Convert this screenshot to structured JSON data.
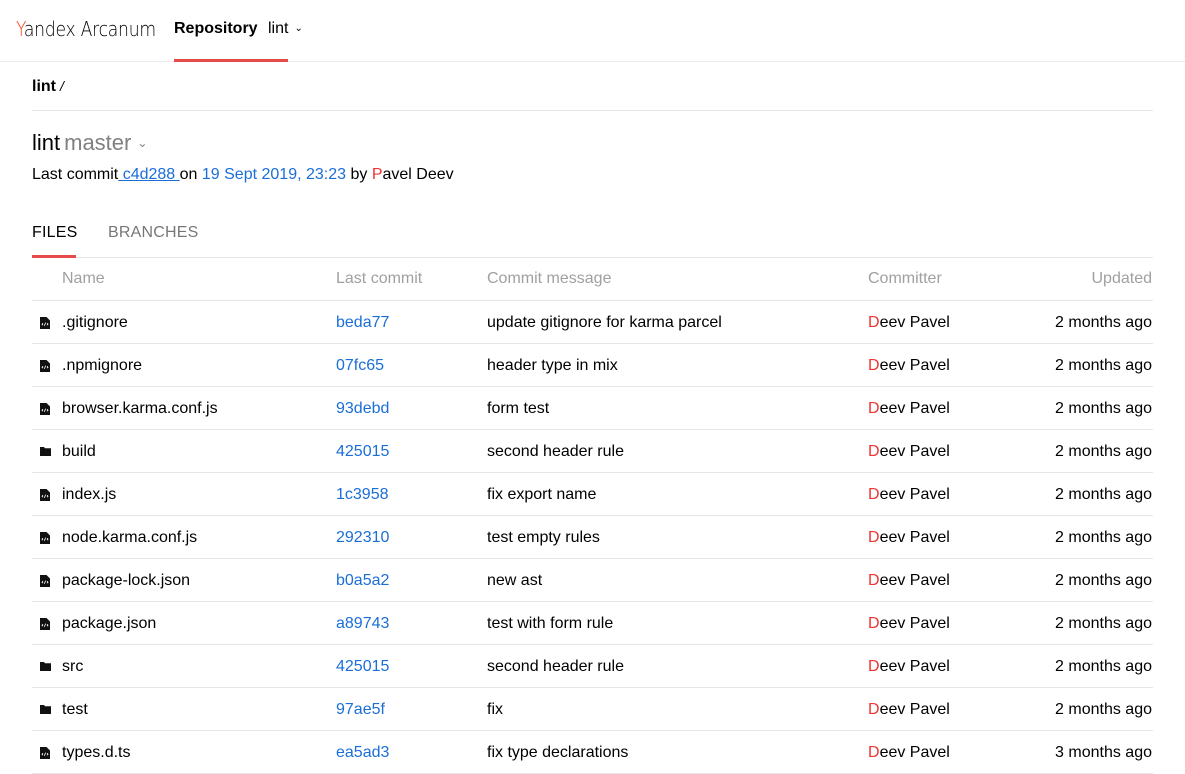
{
  "header": {
    "logo_yandex_first": "Y",
    "logo_yandex_rest": "andex",
    "logo_product": "Arcanum",
    "nav_label": "Repository",
    "repo_selector": "lint"
  },
  "breadcrumb": {
    "repo": "lint",
    "separator": "/"
  },
  "repo": {
    "name": "lint",
    "branch": "master"
  },
  "last_commit": {
    "prefix": "Last commit",
    "hash": " c4d288 ",
    "on": "on ",
    "date": "19 Sept 2019, 23:23",
    "by": " by ",
    "author_first": "P",
    "author_rest": "avel Deev"
  },
  "tabs": [
    {
      "label": "FILES",
      "active": true
    },
    {
      "label": "BRANCHES",
      "active": false
    }
  ],
  "table": {
    "headers": {
      "name": "Name",
      "last_commit": "Last commit",
      "message": "Commit message",
      "committer": "Committer",
      "updated": "Updated"
    },
    "rows": [
      {
        "type": "file",
        "icon": "file-icon",
        "name": ".gitignore",
        "commit": "beda77",
        "message": "update gitignore for karma parcel",
        "committer_first": "D",
        "committer_rest": "eev Pavel",
        "updated": "2 months ago"
      },
      {
        "type": "file",
        "icon": "file-icon",
        "name": ".npmignore",
        "commit": "07fc65",
        "message": "header type in mix",
        "committer_first": "D",
        "committer_rest": "eev Pavel",
        "updated": "2 months ago"
      },
      {
        "type": "file",
        "icon": "file-icon",
        "name": "browser.karma.conf.js",
        "commit": "93debd",
        "message": "form test",
        "committer_first": "D",
        "committer_rest": "eev Pavel",
        "updated": "2 months ago"
      },
      {
        "type": "folder",
        "icon": "folder-icon",
        "name": "build",
        "commit": "425015",
        "message": "second header rule",
        "committer_first": "D",
        "committer_rest": "eev Pavel",
        "updated": "2 months ago"
      },
      {
        "type": "file",
        "icon": "file-icon",
        "name": "index.js",
        "commit": "1c3958",
        "message": "fix export name",
        "committer_first": "D",
        "committer_rest": "eev Pavel",
        "updated": "2 months ago"
      },
      {
        "type": "file",
        "icon": "file-icon",
        "name": "node.karma.conf.js",
        "commit": "292310",
        "message": "test empty rules",
        "committer_first": "D",
        "committer_rest": "eev Pavel",
        "updated": "2 months ago"
      },
      {
        "type": "file",
        "icon": "file-icon",
        "name": "package-lock.json",
        "commit": "b0a5a2",
        "message": "new ast",
        "committer_first": "D",
        "committer_rest": "eev Pavel",
        "updated": "2 months ago"
      },
      {
        "type": "file",
        "icon": "file-icon",
        "name": "package.json",
        "commit": "a89743",
        "message": "test with form rule",
        "committer_first": "D",
        "committer_rest": "eev Pavel",
        "updated": "2 months ago"
      },
      {
        "type": "folder",
        "icon": "folder-icon",
        "name": "src",
        "commit": "425015",
        "message": "second header rule",
        "committer_first": "D",
        "committer_rest": "eev Pavel",
        "updated": "2 months ago"
      },
      {
        "type": "folder",
        "icon": "folder-icon",
        "name": "test",
        "commit": "97ae5f",
        "message": "fix",
        "committer_first": "D",
        "committer_rest": "eev Pavel",
        "updated": "2 months ago"
      },
      {
        "type": "file",
        "icon": "file-icon",
        "name": "types.d.ts",
        "commit": "ea5ad3",
        "message": "fix type declarations",
        "committer_first": "D",
        "committer_rest": "eev Pavel",
        "updated": "3 months ago"
      }
    ]
  },
  "colors": {
    "accent": "#e64a4a",
    "link": "#1a6ed8",
    "avatar_letter": "#e33",
    "muted": "#a0a0a0"
  }
}
